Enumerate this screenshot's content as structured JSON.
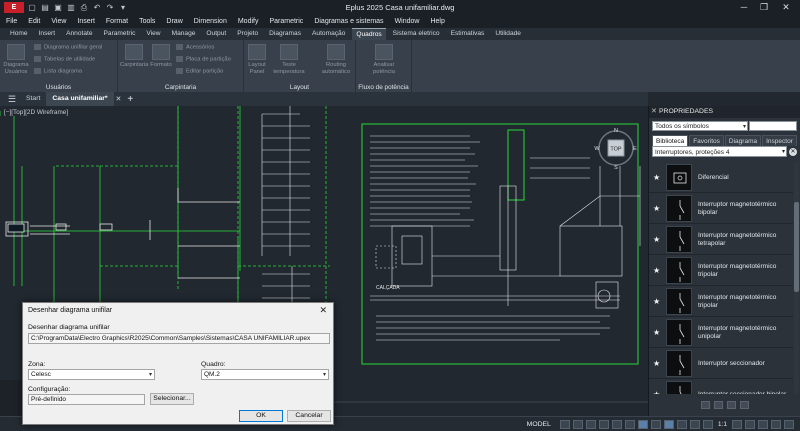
{
  "titlebar": {
    "title": "Eplus 2025   Casa unifamiliar.dwg",
    "app_logo": "E"
  },
  "menu": [
    "File",
    "Edit",
    "View",
    "Insert",
    "Format",
    "Tools",
    "Draw",
    "Dimension",
    "Modify",
    "Parametric",
    "Diagramas e sistemas",
    "Window",
    "Help"
  ],
  "ribbon_tabs": [
    "Home",
    "Insert",
    "Annotate",
    "Parametric",
    "View",
    "Manage",
    "Output",
    "Projeto",
    "Diagramas",
    "Automação",
    "Quadros",
    "Sistema eletrico",
    "Estimativas",
    "Utilidade"
  ],
  "ribbon_active_tab": "Quadros",
  "ribbon": {
    "usuarios": {
      "label": "Usuários",
      "big": "Diagrama Usuários",
      "small": [
        "Diagrama unifilar geral",
        "Tabelas de utilidade",
        "Lista diagrama"
      ]
    },
    "carpintaria": {
      "label": "Carpintaria",
      "big1": "Carpintaria",
      "big2": "Formato",
      "small": [
        "Acessórios",
        "Placa de partição",
        "Editar partição"
      ]
    },
    "layout": {
      "label": "Layout",
      "big1": "Layout Panel",
      "big2": "Teste temperatura",
      "big3": "Routing automático"
    },
    "fluxo": {
      "label": "Fluxo de potência",
      "big": "Analisar potência"
    }
  },
  "file_tabs": [
    "Start",
    "Casa unifamiliar*"
  ],
  "drawing": {
    "view_label": "[−][Top][2D Wireframe]",
    "viewcube": {
      "face": "TOP",
      "n": "N",
      "s": "S",
      "e": "E",
      "w": "W"
    },
    "caption": "CALÇADA"
  },
  "statusbar": {
    "model": "MODEL",
    "scale": "1:1"
  },
  "properties": {
    "title": "PROPRIEDADES",
    "filter": "Todos os símbolos",
    "tabs": [
      "Biblioteca",
      "Favoritos",
      "Diagrama",
      "Inspector"
    ],
    "active_tab": "Biblioteca",
    "category": "Interruptores, proteções 4",
    "symbols": [
      "Diferencial",
      "Interruptor magnetotérmico bipolar",
      "Interruptor magnetotérmico tetrapolar",
      "Interruptor magnetotérmico tripolar",
      "Interruptor magnetotérmico tripolar",
      "Interruptor magnetotérmico unipolar",
      "Interruptor seccionador",
      "Interruptor seccionador bipolar"
    ]
  },
  "dialog": {
    "title": "Desenhar diagrama unifilar",
    "file_label": "Desenhar diagrama unifilar",
    "file_path": "C:\\ProgramData\\Electro Graphics\\R2025\\Common\\Samples\\Sistemas\\CASA UNIFAMILIAR.upex",
    "zona_label": "Zona:",
    "zona_value": "Celesc",
    "quadro_label": "Quadro:",
    "quadro_value": "QM.2",
    "config_label": "Configuração:",
    "config_value": "Pré-definido",
    "select_button": "Selecionar...",
    "ok_button": "OK",
    "cancel_button": "Cancelar"
  },
  "colors": {
    "cad_green": "#28d838",
    "cad_white": "#e8e8e8",
    "background": "#212830",
    "accent": "#0078d7"
  }
}
